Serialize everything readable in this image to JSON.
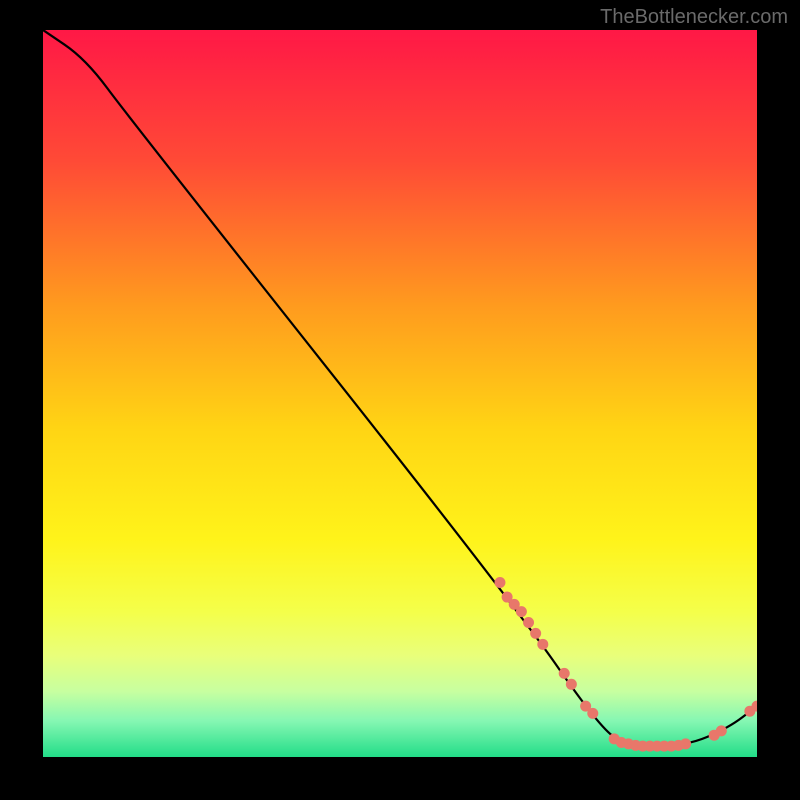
{
  "watermark": "TheBottlenecker.com",
  "chart_data": {
    "type": "line",
    "title": "",
    "xlabel": "",
    "ylabel": "",
    "xlim": [
      0,
      100
    ],
    "ylim": [
      0,
      100
    ],
    "curve": [
      {
        "x": 0,
        "y": 100
      },
      {
        "x": 6,
        "y": 96
      },
      {
        "x": 12,
        "y": 88
      },
      {
        "x": 66,
        "y": 21
      },
      {
        "x": 78,
        "y": 4
      },
      {
        "x": 82,
        "y": 1.5
      },
      {
        "x": 90,
        "y": 1.5
      },
      {
        "x": 96,
        "y": 4
      },
      {
        "x": 100,
        "y": 7
      }
    ],
    "scatter_points": [
      {
        "x": 64,
        "y": 24
      },
      {
        "x": 65,
        "y": 22
      },
      {
        "x": 66,
        "y": 21
      },
      {
        "x": 67,
        "y": 20
      },
      {
        "x": 68,
        "y": 18.5
      },
      {
        "x": 69,
        "y": 17
      },
      {
        "x": 70,
        "y": 15.5
      },
      {
        "x": 73,
        "y": 11.5
      },
      {
        "x": 74,
        "y": 10
      },
      {
        "x": 76,
        "y": 7
      },
      {
        "x": 77,
        "y": 6
      },
      {
        "x": 80,
        "y": 2.5
      },
      {
        "x": 81,
        "y": 2
      },
      {
        "x": 82,
        "y": 1.8
      },
      {
        "x": 83,
        "y": 1.6
      },
      {
        "x": 84,
        "y": 1.5
      },
      {
        "x": 85,
        "y": 1.5
      },
      {
        "x": 86,
        "y": 1.5
      },
      {
        "x": 87,
        "y": 1.5
      },
      {
        "x": 88,
        "y": 1.5
      },
      {
        "x": 89,
        "y": 1.6
      },
      {
        "x": 90,
        "y": 1.8
      },
      {
        "x": 94,
        "y": 3
      },
      {
        "x": 95,
        "y": 3.6
      },
      {
        "x": 99,
        "y": 6.3
      },
      {
        "x": 100,
        "y": 7
      }
    ],
    "gradient_stops": [
      {
        "offset": 0,
        "color": "#ff1846"
      },
      {
        "offset": 18,
        "color": "#ff4a36"
      },
      {
        "offset": 38,
        "color": "#ff9b1e"
      },
      {
        "offset": 55,
        "color": "#ffd514"
      },
      {
        "offset": 70,
        "color": "#fff31a"
      },
      {
        "offset": 80,
        "color": "#f4ff4a"
      },
      {
        "offset": 86,
        "color": "#e9ff7a"
      },
      {
        "offset": 91,
        "color": "#c7ffa0"
      },
      {
        "offset": 95,
        "color": "#86f7b3"
      },
      {
        "offset": 100,
        "color": "#22dd88"
      }
    ],
    "point_color": "#e8776a",
    "line_color": "#000000"
  }
}
